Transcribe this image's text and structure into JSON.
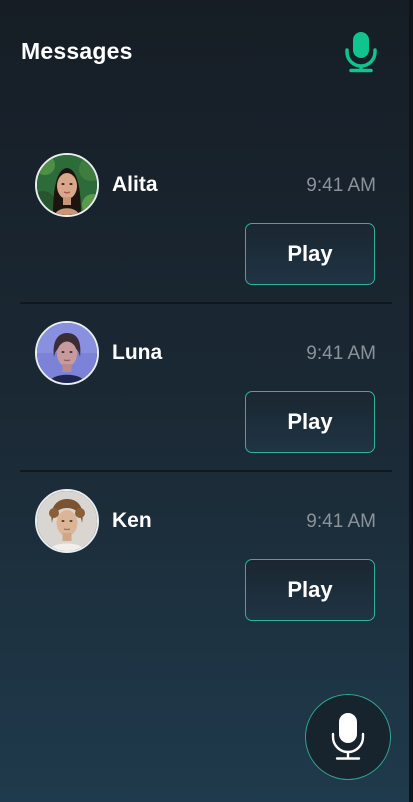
{
  "header": {
    "title": "Messages",
    "mic_icon": "microphone-icon",
    "accent_color": "#10c48e"
  },
  "messages": [
    {
      "name": "Alita",
      "time": "9:41 AM",
      "play_label": "Play",
      "avatar": "avatar-photo"
    },
    {
      "name": "Luna",
      "time": "9:41 AM",
      "play_label": "Play",
      "avatar": "avatar-photo"
    },
    {
      "name": "Ken",
      "time": "9:41 AM",
      "play_label": "Play",
      "avatar": "avatar-photo"
    }
  ],
  "record_button": {
    "icon": "microphone-icon",
    "border_color": "#2fa58f"
  }
}
